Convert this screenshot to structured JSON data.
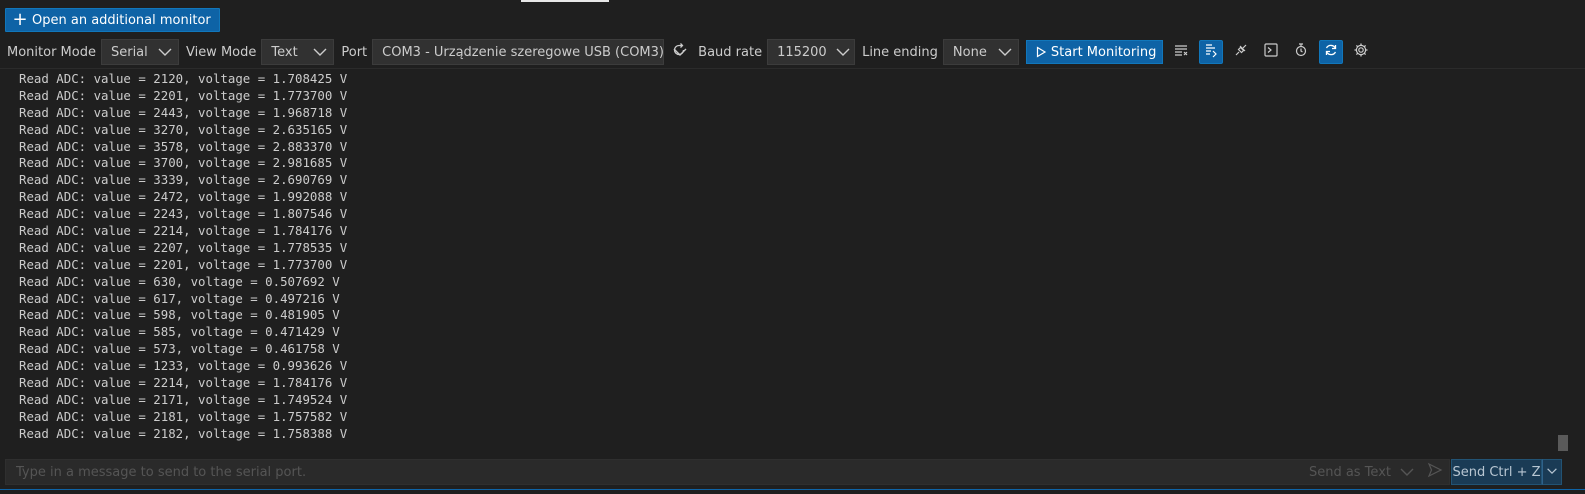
{
  "header": {
    "open_monitor_label": "Open an additional monitor"
  },
  "toolbar": {
    "monitor_mode_label": "Monitor Mode",
    "monitor_mode_value": "Serial",
    "view_mode_label": "View Mode",
    "view_mode_value": "Text",
    "port_label": "Port",
    "port_value": "COM3 - Urządzenie szeregowe USB (COM3)",
    "baud_rate_label": "Baud rate",
    "baud_rate_value": "115200",
    "line_ending_label": "Line ending",
    "line_ending_value": "None",
    "start_label": "Start Monitoring",
    "icons": [
      "refresh-icon",
      "clear-output-icon",
      "toggle-word-wrap-icon",
      "plug-icon",
      "terminal-icon",
      "timestamp-icon",
      "auto-scroll-icon",
      "settings-icon"
    ]
  },
  "output": {
    "lines": [
      "Read ADC: value = 2120, voltage = 1.708425 V",
      "Read ADC: value = 2201, voltage = 1.773700 V",
      "Read ADC: value = 2443, voltage = 1.968718 V",
      "Read ADC: value = 3270, voltage = 2.635165 V",
      "Read ADC: value = 3578, voltage = 2.883370 V",
      "Read ADC: value = 3700, voltage = 2.981685 V",
      "Read ADC: value = 3339, voltage = 2.690769 V",
      "Read ADC: value = 2472, voltage = 1.992088 V",
      "Read ADC: value = 2243, voltage = 1.807546 V",
      "Read ADC: value = 2214, voltage = 1.784176 V",
      "Read ADC: value = 2207, voltage = 1.778535 V",
      "Read ADC: value = 2201, voltage = 1.773700 V",
      "Read ADC: value = 630, voltage = 0.507692 V",
      "Read ADC: value = 617, voltage = 0.497216 V",
      "Read ADC: value = 598, voltage = 0.481905 V",
      "Read ADC: value = 585, voltage = 0.471429 V",
      "Read ADC: value = 573, voltage = 0.461758 V",
      "Read ADC: value = 1233, voltage = 0.993626 V",
      "Read ADC: value = 2214, voltage = 1.784176 V",
      "Read ADC: value = 2171, voltage = 1.749524 V",
      "Read ADC: value = 2181, voltage = 1.757582 V",
      "Read ADC: value = 2182, voltage = 1.758388 V"
    ]
  },
  "send": {
    "placeholder": "Type in a message to send to the serial port.",
    "mode_label": "Send as Text",
    "button_label": "Send Ctrl + Z"
  },
  "colors": {
    "accent": "#0e63a6",
    "background": "#1f1f1f"
  }
}
